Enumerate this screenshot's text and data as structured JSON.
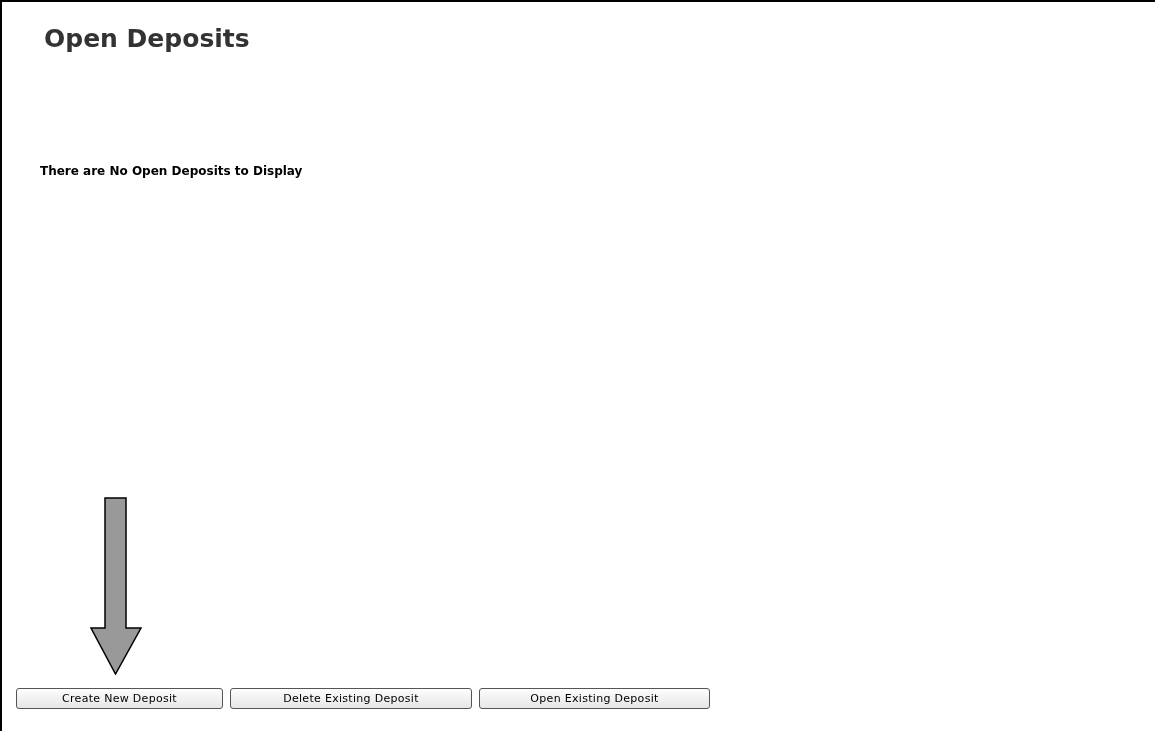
{
  "title": "Open Deposits",
  "message": "There are No Open Deposits to Display",
  "buttons": [
    {
      "label": "Create New Deposit"
    },
    {
      "label": "Delete Existing Deposit"
    },
    {
      "label": "Open Existing Deposit"
    }
  ]
}
